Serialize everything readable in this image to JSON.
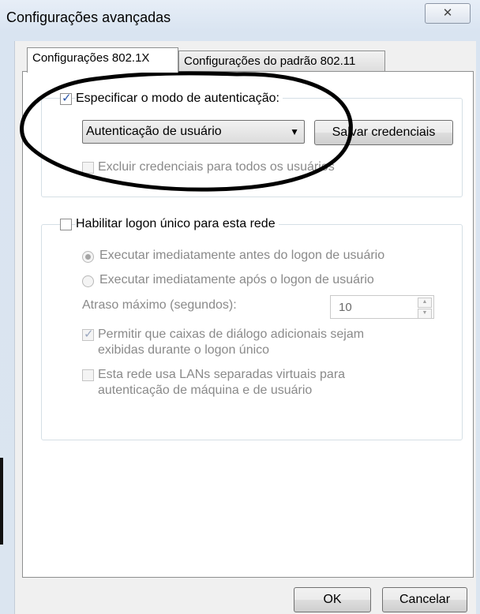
{
  "window": {
    "title": "Configurações avançadas",
    "close_glyph": "✕"
  },
  "tabs": [
    {
      "label": "Configurações 802.1X",
      "active": true
    },
    {
      "label": "Configurações do padrão 802.11",
      "active": false
    }
  ],
  "auth_section": {
    "specify_label": "Especificar o modo de autenticação:",
    "specify_checked": true,
    "mode_selected": "Autenticação de usuário",
    "save_credentials_label": "Salvar credenciais",
    "delete_credentials_label": "Excluir credenciais para todos os usuários",
    "delete_credentials_checked": false
  },
  "sso_section": {
    "enable_label": "Habilitar logon único para esta rede",
    "enable_checked": false,
    "radio_before_label": "Executar imediatamente antes do logon de usuário",
    "radio_after_label": "Executar imediatamente após o logon de usuário",
    "delay_label": "Atraso máximo (segundos):",
    "delay_value": "10",
    "allow_dialogs_line1": "Permitir que caixas de diálogo adicionais sejam",
    "allow_dialogs_line2": "exibidas durante o logon único",
    "allow_dialogs_checked": true,
    "vlan_line1": "Esta rede usa LANs separadas virtuais para",
    "vlan_line2": "autenticação de máquina e de usuário",
    "vlan_checked": false
  },
  "footer": {
    "ok_label": "OK",
    "cancel_label": "Cancelar"
  },
  "annotation": {
    "shape": "hand-drawn ellipse",
    "color": "#000000"
  }
}
